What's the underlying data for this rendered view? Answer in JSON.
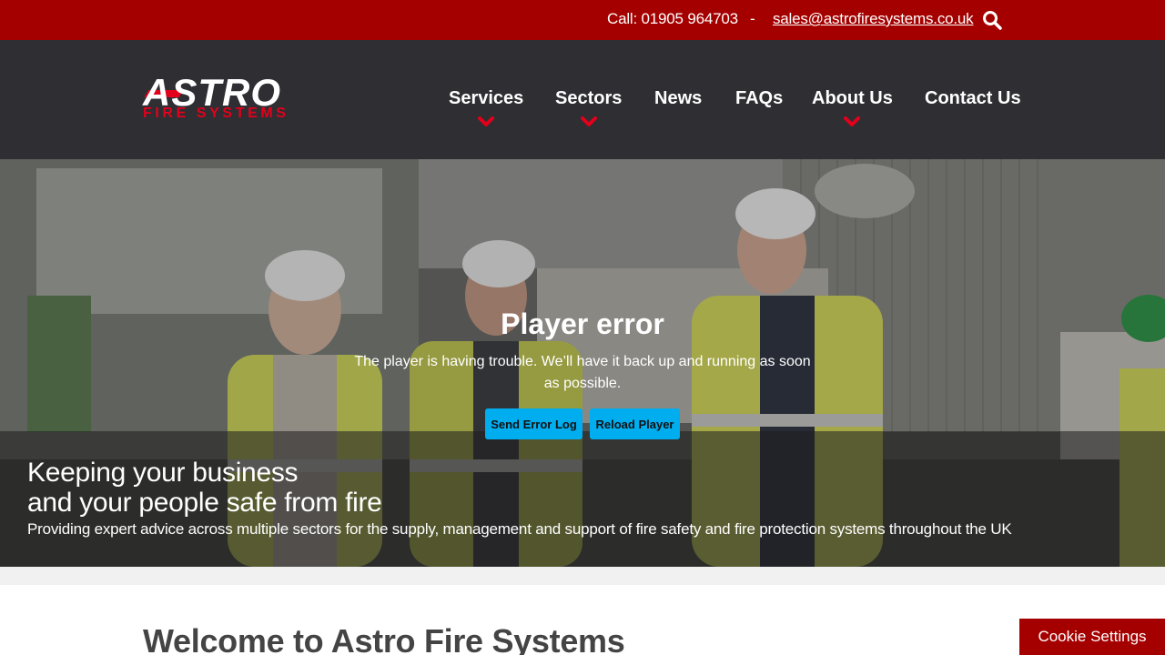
{
  "topbar": {
    "phone": "Call: 01905 964703",
    "separator": "-",
    "email": "sales@astrofiresystems.co.uk",
    "search_icon": "search-icon"
  },
  "logo": {
    "word": "ASTRO",
    "sub": "FIRE SYSTEMS"
  },
  "nav": {
    "items": [
      {
        "label": "Services",
        "has_dropdown": true
      },
      {
        "label": "Sectors",
        "has_dropdown": true
      },
      {
        "label": "News",
        "has_dropdown": false
      },
      {
        "label": "FAQs",
        "has_dropdown": false
      },
      {
        "label": "About Us",
        "has_dropdown": true
      },
      {
        "label": "Contact Us",
        "has_dropdown": false
      }
    ]
  },
  "player": {
    "title": "Player error",
    "message": "The player is having trouble. We’ll have it back up and running as soon as possible.",
    "send_log": "Send Error Log",
    "reload": "Reload Player"
  },
  "hero": {
    "title_line1": "Keeping your business",
    "title_line2": "and your people safe from fire",
    "subtitle": "Providing expert advice across multiple sectors for the supply, management and support of fire safety and fire protection systems throughout the UK"
  },
  "welcome": "Welcome to Astro Fire Systems",
  "cookie": "Cookie Settings",
  "colors": {
    "brand_red": "#a50000",
    "logo_red": "#e3001b",
    "header_dark": "#2e2e33",
    "player_button": "#00adef"
  }
}
